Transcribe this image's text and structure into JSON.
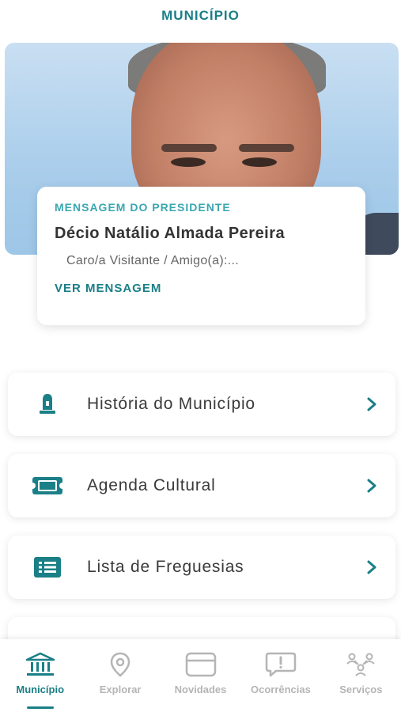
{
  "header": {
    "title": "MUNICÍPIO"
  },
  "message_card": {
    "overline": "MENSAGEM DO PRESIDENTE",
    "name": "Décio Natálio Almada Pereira",
    "excerpt": "Caro/a Visitante / Amigo(a):...",
    "link": "VER MENSAGEM"
  },
  "menu": [
    {
      "label": "História do Município",
      "icon": "monument-icon"
    },
    {
      "label": "Agenda Cultural",
      "icon": "ticket-icon"
    },
    {
      "label": "Lista de Freguesias",
      "icon": "list-icon"
    }
  ],
  "nav": [
    {
      "label": "Município",
      "icon": "townhall-icon",
      "active": true
    },
    {
      "label": "Explorar",
      "icon": "location-pin-icon",
      "active": false
    },
    {
      "label": "Novidades",
      "icon": "news-card-icon",
      "active": false
    },
    {
      "label": "Ocorrências",
      "icon": "alert-bubble-icon",
      "active": false
    },
    {
      "label": "Serviços",
      "icon": "people-network-icon",
      "active": false
    }
  ],
  "colors": {
    "primary": "#1a7f86",
    "accent": "#3aa7b0",
    "inactive": "#b5b5b5"
  }
}
